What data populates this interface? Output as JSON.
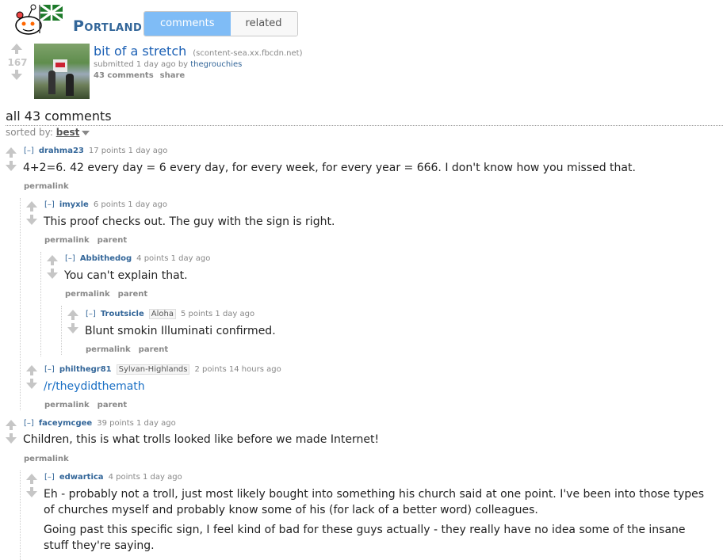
{
  "subreddit": {
    "name": "Portland"
  },
  "tabs": [
    {
      "label": "comments",
      "active": true
    },
    {
      "label": "related",
      "active": false
    }
  ],
  "post": {
    "score": "167",
    "title": "bit of a stretch",
    "domain": "(scontent-sea.xx.fbcdn.net)",
    "submitted": "submitted 1 day ago by ",
    "author": "thegrouchies",
    "comments_label": "43 comments",
    "share_label": "share"
  },
  "comments_header": "all 43 comments",
  "sort": {
    "prefix": "sorted by: ",
    "value": "best"
  },
  "comments": [
    {
      "expand": "[–]",
      "author": "drahma23",
      "flair": "",
      "meta": "17 points 1 day ago",
      "body": "4+2=6. 42 every day = 6 every day, for every week, for every year = 666. I don't know how you missed that.",
      "links": [
        "permalink"
      ]
    },
    {
      "expand": "[–]",
      "author": "imyxle",
      "flair": "",
      "meta": "6 points 1 day ago",
      "body": "This proof checks out. The guy with the sign is right.",
      "links": [
        "permalink",
        "parent"
      ]
    },
    {
      "expand": "[–]",
      "author": "Abbithedog",
      "flair": "",
      "meta": "4 points 1 day ago",
      "body": "You can't explain that.",
      "links": [
        "permalink",
        "parent"
      ]
    },
    {
      "expand": "[–]",
      "author": "Troutsicle",
      "flair": "Aloha",
      "meta": "5 points 1 day ago",
      "body": "Blunt smokin Illuminati confirmed.",
      "links": [
        "permalink",
        "parent"
      ]
    },
    {
      "expand": "[–]",
      "author": "philthegr81",
      "flair": "Sylvan-Highlands",
      "meta": "2 points 14 hours ago",
      "body": "/r/theydidthemath",
      "links": [
        "permalink",
        "parent"
      ]
    },
    {
      "expand": "[–]",
      "author": "faceymcgee",
      "flair": "",
      "meta": "39 points 1 day ago",
      "body": "Children, this is what trolls looked like before we made Internet!",
      "links": [
        "permalink"
      ]
    },
    {
      "expand": "[–]",
      "author": "edwartica",
      "flair": "",
      "meta": "4 points 1 day ago",
      "body": "Eh - probably not a troll, just most likely bought into something his church said at one point. I've been into those types of churches myself and probably know some of his (for lack of a better word) colleagues.",
      "body2": "Going past this specific sign, I feel kind of bad for these guys actually - they really have no idea some of the insane stuff they're saying.",
      "links": []
    }
  ]
}
